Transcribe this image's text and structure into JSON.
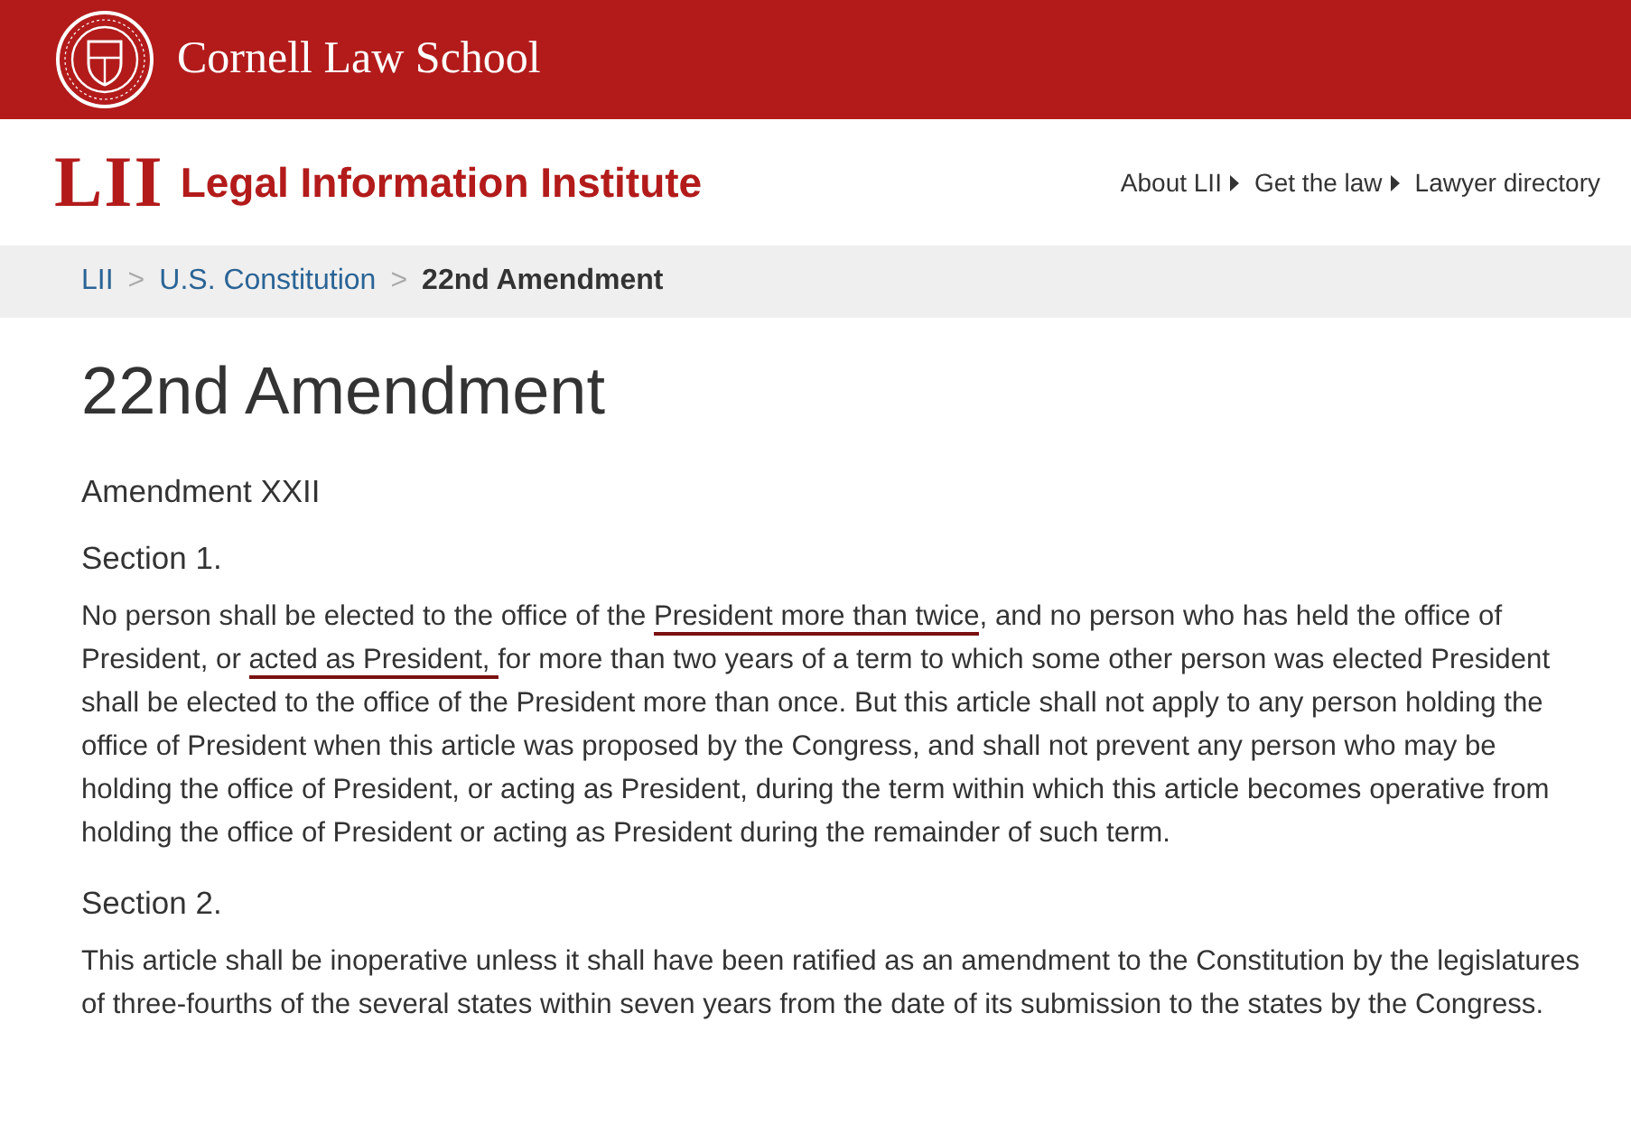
{
  "header": {
    "school": "Cornell Law School"
  },
  "brand": {
    "mark": "LII",
    "name": "Legal Information Institute"
  },
  "nav": [
    {
      "label": "About LII",
      "caret": true
    },
    {
      "label": "Get the law",
      "caret": true
    },
    {
      "label": "Lawyer directory",
      "caret": false
    }
  ],
  "breadcrumb": [
    {
      "label": "LII",
      "current": false
    },
    {
      "label": "U.S. Constitution",
      "current": false
    },
    {
      "label": "22nd Amendment",
      "current": true
    }
  ],
  "breadcrumb_separator": ">",
  "title": "22nd Amendment",
  "subtitle": "Amendment XXII",
  "sections": [
    {
      "heading": "Section 1.",
      "segments": [
        {
          "text": "No person shall be elected to the office of the ",
          "underlined": false
        },
        {
          "text": "President more than twice",
          "underlined": true
        },
        {
          "text": ", and no person who has held the office of President, or ",
          "underlined": false
        },
        {
          "text": "acted as President, ",
          "underlined": true
        },
        {
          "text": "for more than two years of a term to which some other person was elected President shall be elected to the office of the President more than once. But this article shall not apply to any person holding the office of President when this article was proposed by the Congress, and shall not prevent any person who may be holding the office of President, or acting as President, during the term within which this article becomes operative from holding the office of President or acting as President during the remainder of such term.",
          "underlined": false
        }
      ]
    },
    {
      "heading": "Section 2.",
      "segments": [
        {
          "text": "This article shall be inoperative unless it shall have been ratified as an amendment to the Constitution by the legislatures of three-fourths of the several states within seven years from the date of its submission to the states by the Congress.",
          "underlined": false
        }
      ]
    }
  ]
}
